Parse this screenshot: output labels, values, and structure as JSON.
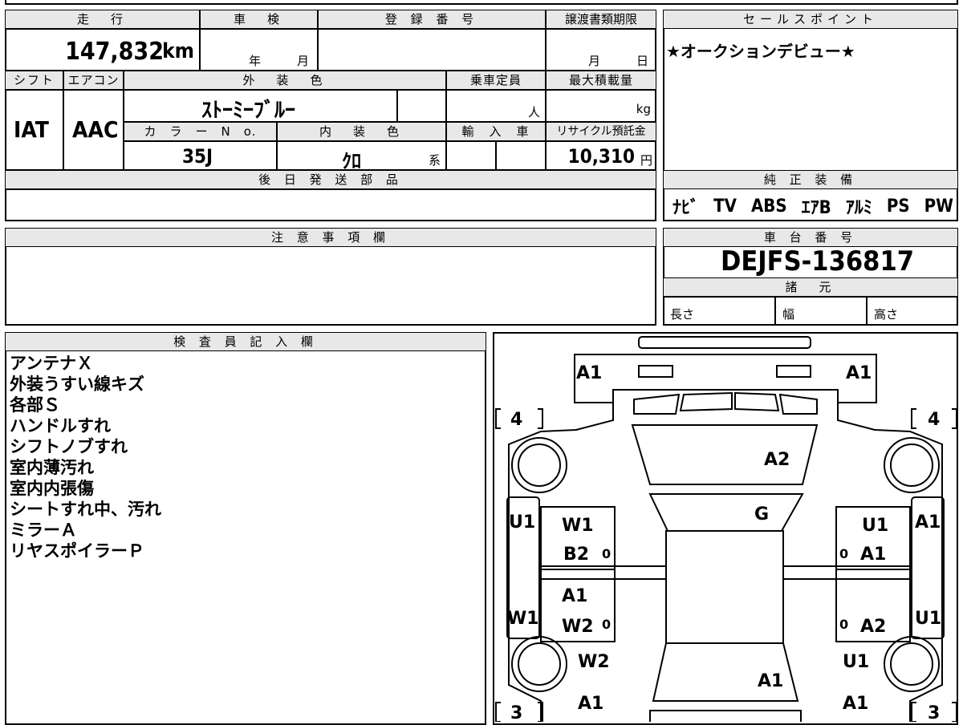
{
  "spec": {
    "mileage_header": "走　行",
    "mileage_value": "147,832",
    "mileage_unit": "km",
    "shaken_header": "車　検",
    "shaken_year": "年",
    "shaken_month": "月",
    "reg_header": "登 録 番 号",
    "transfer_header": "譲渡書類期限",
    "transfer_month": "月",
    "transfer_day": "日",
    "shift_header": "シフト",
    "shift_value": "IAT",
    "ac_header": "エアコン",
    "ac_value": "AAC",
    "exterior_header": "外　装　色",
    "exterior_value": "ｽﾄｰﾐｰﾌﾞﾙｰ",
    "capacity_header": "乗車定員",
    "capacity_unit": "人",
    "load_header": "最大積載量",
    "load_unit": "kg",
    "color_no_header": "カ　ラ　ー　N　o.",
    "color_no_value": "35J",
    "interior_header": "内　装　色",
    "interior_value": "ｸﾛ",
    "interior_suffix": "系",
    "import_header": "輸　入　車",
    "recycle_header": "リサイクル預託金",
    "recycle_value": "10,310",
    "recycle_unit": "円",
    "later_parts_header": "後 日 発 送 部 品"
  },
  "sales": {
    "header": "セールスポイント",
    "text": "★オークションデビュー★"
  },
  "equipment": {
    "header": "純 正 装 備",
    "items": [
      "ﾅﾋﾞ",
      "TV",
      "ABS",
      "ｴｱB",
      "ｱﾙﾐ",
      "PS",
      "PW"
    ]
  },
  "caution": {
    "header": "注 意 事 項 欄"
  },
  "chassis": {
    "header": "車 台 番 号",
    "value": "DEJFS-136817",
    "specs_header": "諸　元",
    "length": "長さ",
    "width": "幅",
    "height": "高さ"
  },
  "inspector": {
    "header": "検 査 員 記 入 欄",
    "notes": [
      "アンテナＸ",
      "外装うすい線キズ",
      "各部Ｓ",
      "ハンドルすれ",
      "シフトノブすれ",
      "室内薄汚れ",
      "室内内張傷",
      "シートすれ中、汚れ",
      "ミラーＡ",
      "リヤスポイラーＰ"
    ]
  },
  "diagram": {
    "marks": {
      "front_left": "A1",
      "front_right": "A1",
      "tire_fl": "4",
      "tire_fr": "4",
      "hood": "A2",
      "windshield": "G",
      "left_upper_panel": "U1",
      "left_front_door_1": "W1",
      "left_front_door_2": "B2",
      "right_front_door_1": "U1",
      "right_front_door_2": "A1",
      "right_fender": "A1",
      "left_rear_door_1": "A1",
      "left_rear_door_2": "W2",
      "left_rear_panel": "W1",
      "right_rear_door": "A2",
      "right_rear_panel": "U1",
      "left_quarter": "W2",
      "right_quarter": "U1",
      "roof_rear": "A1",
      "rear_left": "A1",
      "rear_right": "A1",
      "tire_rl": "3",
      "tire_rr": "3",
      "zero": "0"
    }
  }
}
